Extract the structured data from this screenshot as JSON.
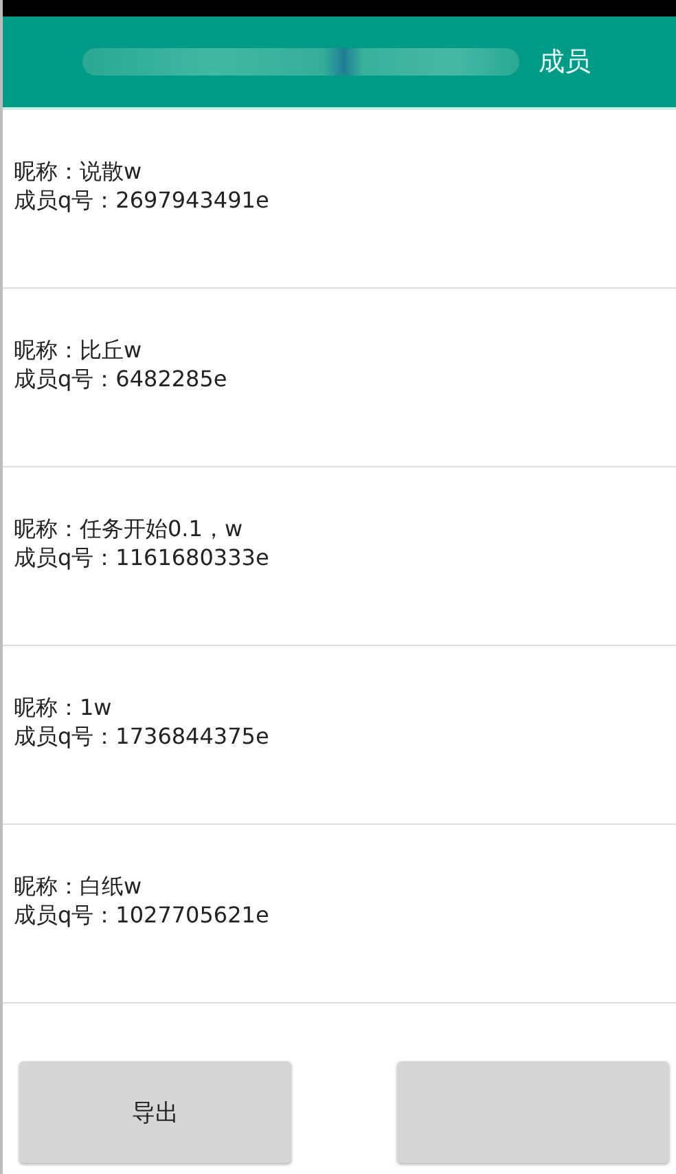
{
  "header": {
    "title": "成员"
  },
  "members": [
    {
      "nickname": "昵称：说散w",
      "qq": "成员q号：2697943491e"
    },
    {
      "nickname": "昵称：比丘w",
      "qq": "成员q号：6482285e"
    },
    {
      "nickname": "昵称：任务开始0.1，w",
      "qq": "成员q号：1161680333e"
    },
    {
      "nickname": "昵称：1w",
      "qq": "成员q号：1736844375e"
    },
    {
      "nickname": "昵称：白纸w",
      "qq": "成员q号：1027705621e"
    }
  ],
  "buttons": [
    {
      "kind": "labeled",
      "label": "导出"
    },
    {
      "kind": "covered"
    }
  ]
}
